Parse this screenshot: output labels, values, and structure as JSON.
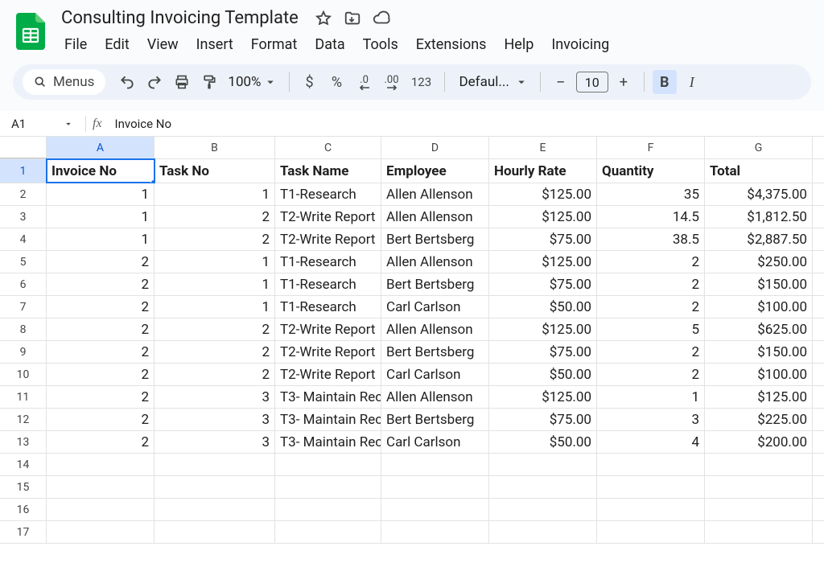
{
  "doc": {
    "title": "Consulting Invoicing Template"
  },
  "menus": [
    "File",
    "Edit",
    "View",
    "Insert",
    "Format",
    "Data",
    "Tools",
    "Extensions",
    "Help",
    "Invoicing"
  ],
  "toolbar": {
    "menus_label": "Menus",
    "zoom": "100%",
    "font_name": "Defaul...",
    "font_size": "10",
    "currency": "$",
    "percent": "%",
    "dec_down": ".0",
    "dec_up": ".00",
    "num_fmt": "123",
    "minus": "−",
    "plus": "+",
    "bold": "B",
    "italic": "I"
  },
  "name_box": {
    "ref": "A1",
    "formula": "Invoice No"
  },
  "columns": [
    "A",
    "B",
    "C",
    "D",
    "E",
    "F",
    "G"
  ],
  "headers": [
    "Invoice No",
    "Task No",
    "Task Name",
    "Employee",
    "Hourly Rate",
    "Quantity",
    "Total"
  ],
  "rows": [
    {
      "n": "2",
      "d": [
        "1",
        "1",
        "T1-Research",
        "Allen Allenson",
        "$125.00",
        "35",
        "$4,375.00"
      ]
    },
    {
      "n": "3",
      "d": [
        "1",
        "2",
        "T2-Write Report",
        "Allen Allenson",
        "$125.00",
        "14.5",
        "$1,812.50"
      ]
    },
    {
      "n": "4",
      "d": [
        "1",
        "2",
        "T2-Write Report",
        "Bert Bertsberg",
        "$75.00",
        "38.5",
        "$2,887.50"
      ]
    },
    {
      "n": "5",
      "d": [
        "2",
        "1",
        "T1-Research",
        "Allen Allenson",
        "$125.00",
        "2",
        "$250.00"
      ]
    },
    {
      "n": "6",
      "d": [
        "2",
        "1",
        "T1-Research",
        "Bert Bertsberg",
        "$75.00",
        "2",
        "$150.00"
      ]
    },
    {
      "n": "7",
      "d": [
        "2",
        "1",
        "T1-Research",
        "Carl Carlson",
        "$50.00",
        "2",
        "$100.00"
      ]
    },
    {
      "n": "8",
      "d": [
        "2",
        "2",
        "T2-Write Report",
        "Allen Allenson",
        "$125.00",
        "5",
        "$625.00"
      ]
    },
    {
      "n": "9",
      "d": [
        "2",
        "2",
        "T2-Write Report",
        "Bert Bertsberg",
        "$75.00",
        "2",
        "$150.00"
      ]
    },
    {
      "n": "10",
      "d": [
        "2",
        "2",
        "T2-Write Report",
        "Carl Carlson",
        "$50.00",
        "2",
        "$100.00"
      ]
    },
    {
      "n": "11",
      "d": [
        "2",
        "3",
        "T3- Maintain Rec",
        "Allen Allenson",
        "$125.00",
        "1",
        "$125.00"
      ]
    },
    {
      "n": "12",
      "d": [
        "2",
        "3",
        "T3- Maintain Rec",
        "Bert Bertsberg",
        "$75.00",
        "3",
        "$225.00"
      ]
    },
    {
      "n": "13",
      "d": [
        "2",
        "3",
        "T3- Maintain Rec",
        "Carl Carlson",
        "$50.00",
        "4",
        "$200.00"
      ]
    },
    {
      "n": "14",
      "d": [
        "",
        "",
        "",
        "",
        "",
        "",
        ""
      ]
    },
    {
      "n": "15",
      "d": [
        "",
        "",
        "",
        "",
        "",
        "",
        ""
      ]
    },
    {
      "n": "16",
      "d": [
        "",
        "",
        "",
        "",
        "",
        "",
        ""
      ]
    },
    {
      "n": "17",
      "d": [
        "",
        "",
        "",
        "",
        "",
        "",
        ""
      ]
    }
  ]
}
